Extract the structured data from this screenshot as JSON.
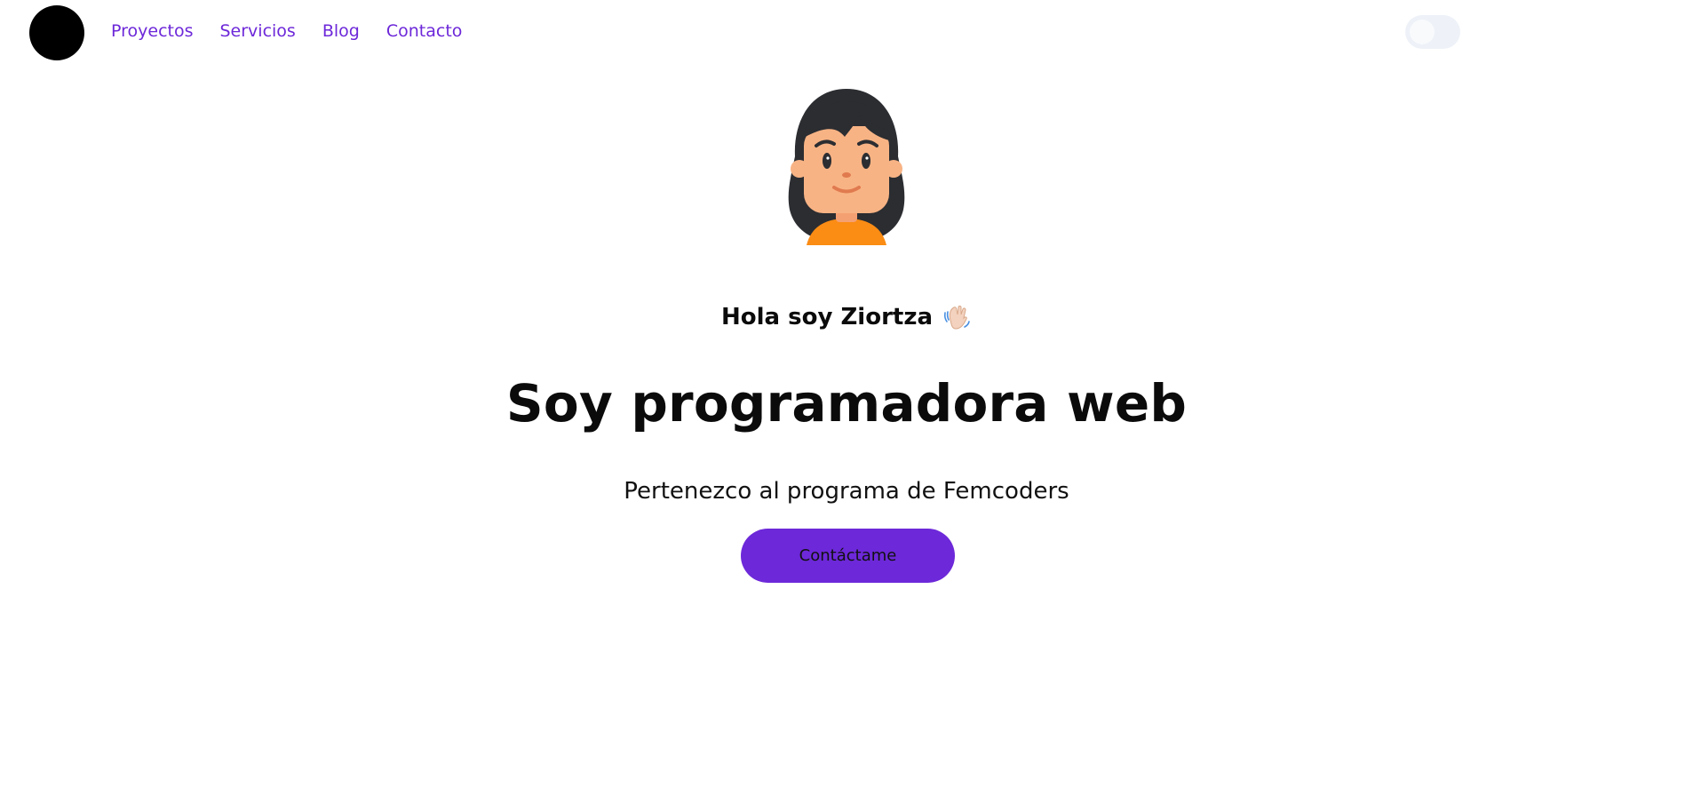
{
  "nav": {
    "logo_icon": "logo-circle",
    "links": [
      {
        "label": "Proyectos"
      },
      {
        "label": "Servicios"
      },
      {
        "label": "Blog"
      },
      {
        "label": "Contacto"
      }
    ],
    "theme_toggle": {
      "state": "off"
    }
  },
  "hero": {
    "avatar_icon": "woman-avatar",
    "greeting": "Hola soy Ziortza",
    "greeting_icon": "waving-hand-icon",
    "headline": "Soy programadora web",
    "subtitle": "Pertenezco al programa de Femcoders",
    "cta_label": "Contáctame"
  },
  "colors": {
    "accent": "#6d28d9",
    "text": "#0b0b0b",
    "background": "#ffffff"
  }
}
